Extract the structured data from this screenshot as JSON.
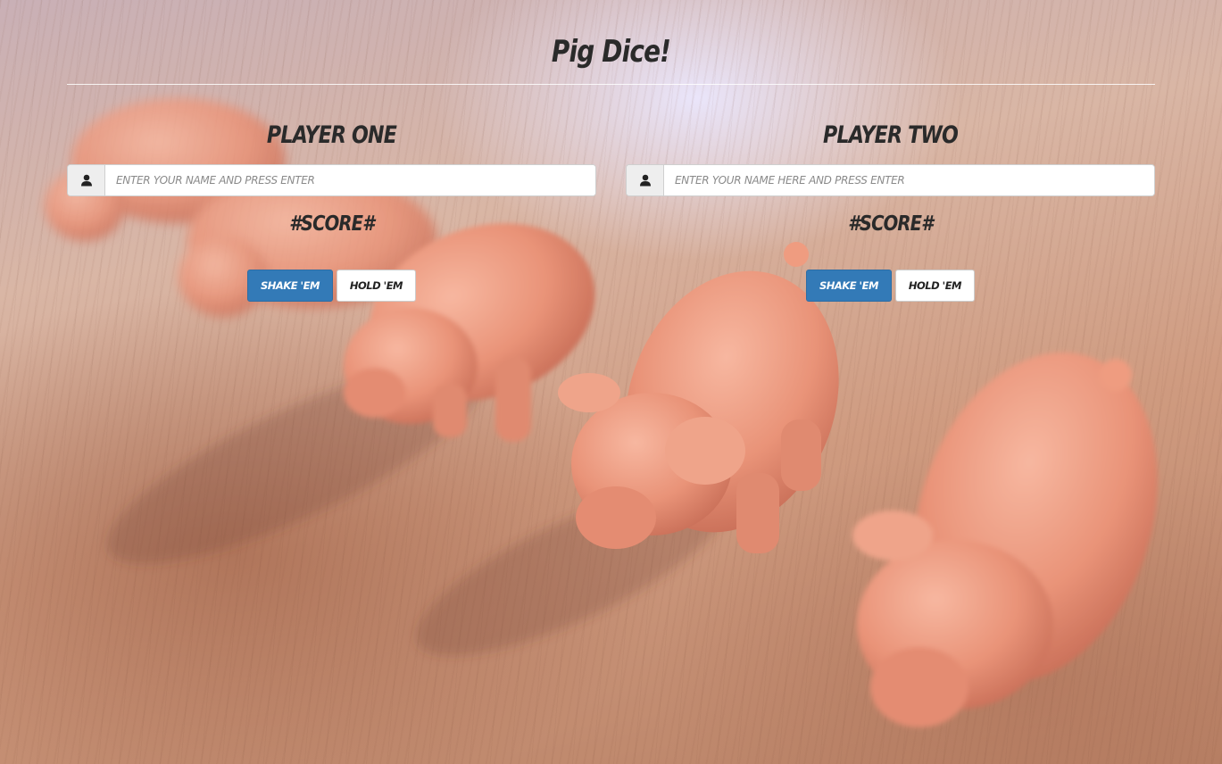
{
  "page": {
    "title": "Pig Dice!"
  },
  "players": [
    {
      "title": "Player One",
      "name_placeholder": "ENTER YOUR NAME AND PRESS ENTER",
      "score": "#SCORE#",
      "shake_label": "SHAKE 'EM",
      "hold_label": "HOLD 'EM"
    },
    {
      "title": "Player Two",
      "name_placeholder": "ENTER YOUR NAME HERE AND PRESS ENTER",
      "score": "#SCORE#",
      "shake_label": "SHAKE 'EM",
      "hold_label": "HOLD 'EM"
    }
  ],
  "icons": {
    "input_addon": "user-icon"
  },
  "colors": {
    "primary_button": "#337ab7",
    "heading_text": "#2a2a2a"
  }
}
